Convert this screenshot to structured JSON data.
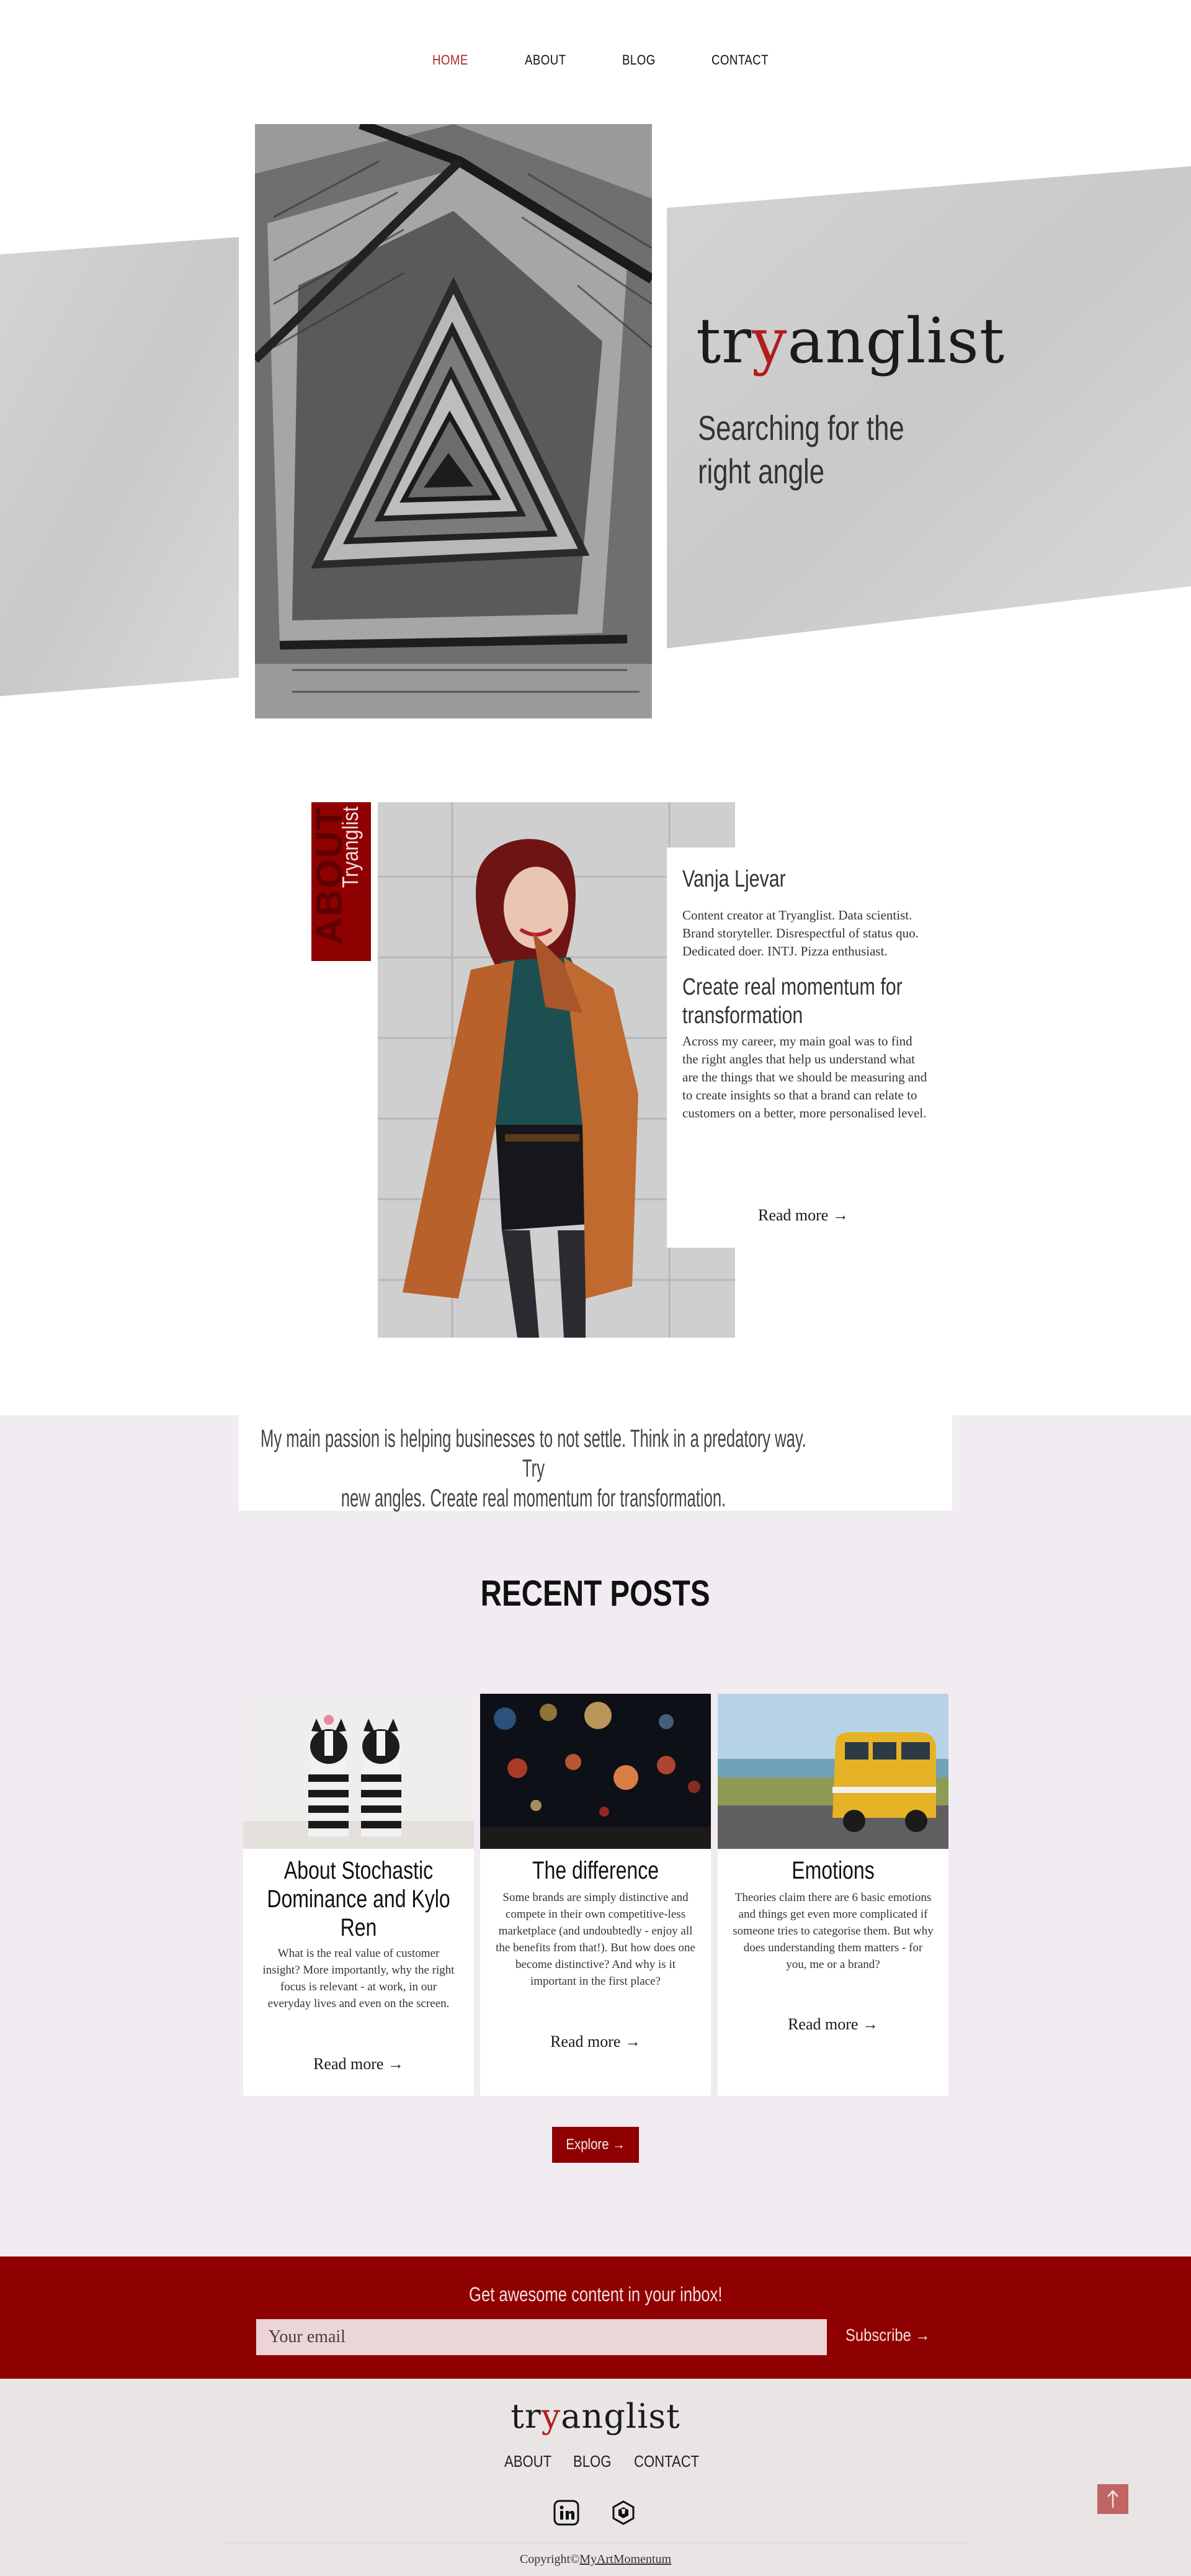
{
  "nav": {
    "items": [
      {
        "label": "HOME",
        "active": true
      },
      {
        "label": "ABOUT",
        "active": false
      },
      {
        "label": "BLOG",
        "active": false
      },
      {
        "label": "CONTACT",
        "active": false
      }
    ]
  },
  "hero": {
    "logo_pre": "tr",
    "logo_y": "y",
    "logo_post": "anglist",
    "tagline_line1": "Searching for the",
    "tagline_line2": "right angle",
    "photo_icon": "spiral-staircase-photo"
  },
  "about": {
    "tab_big": "ABOUT",
    "tab_small": "Tryanglist",
    "name": "Vanja Ljevar",
    "bio": "Content creator at Tryanglist. Data scientist. Brand storyteller. Disrespectful of status quo. Dedicated doer. INTJ. Pizza enthusiast.",
    "heading": "Create real momentum for transformation",
    "text": "Across my career, my main goal was to find the right angles that help us understand what are the things that we should be measuring and to create insights so that a brand can relate to customers on a better, more personalised level.",
    "read_more": "Read more →"
  },
  "passion": {
    "line1": "My main passion is helping businesses to not settle. Think in a predatory way. Try",
    "line2": "new angles. Create real momentum for transformation."
  },
  "recent": {
    "title": "RECENT POSTS",
    "posts": [
      {
        "title": "About Stochastic Dominance and Kylo Ren",
        "excerpt": "What is the real value of customer insight? More importantly, why the right focus is relevant - at work, in our everyday lives and even on the screen.",
        "read_more": "Read more →",
        "image": "dogs-photo"
      },
      {
        "title": "The difference",
        "excerpt": "Some brands are simply distinctive and compete in their own competitive-less marketplace (and undoubtedly - enjoy all the benefits from that!). But how does one become distinctive? And why is it important in the first place?",
        "read_more": "Read more →",
        "image": "bokeh-lights-photo"
      },
      {
        "title": "Emotions",
        "excerpt": "Theories claim there are 6 basic emotions and things get even more complicated if someone tries to categorise them. But why does understanding them matters - for you, me or a brand?",
        "read_more": "Read more →",
        "image": "yellow-van-photo"
      }
    ],
    "explore": "Explore →"
  },
  "newsletter": {
    "title": "Get awesome content in your inbox!",
    "placeholder": "Your email",
    "subscribe": "Subscribe →"
  },
  "footer": {
    "nav": [
      "ABOUT",
      "BLOG",
      "CONTACT"
    ],
    "social_icons": [
      "linkedin-icon",
      "hexagon-badge-icon"
    ],
    "to_top": "↑",
    "copyright": "Copyright©",
    "copyright_link": "MyArtMomentum"
  },
  "colors": {
    "accent": "#8f0000",
    "nav_active": "#b22a2a",
    "lilac_bg": "#f1ecf2",
    "footer_bg": "#e9e5e5"
  }
}
